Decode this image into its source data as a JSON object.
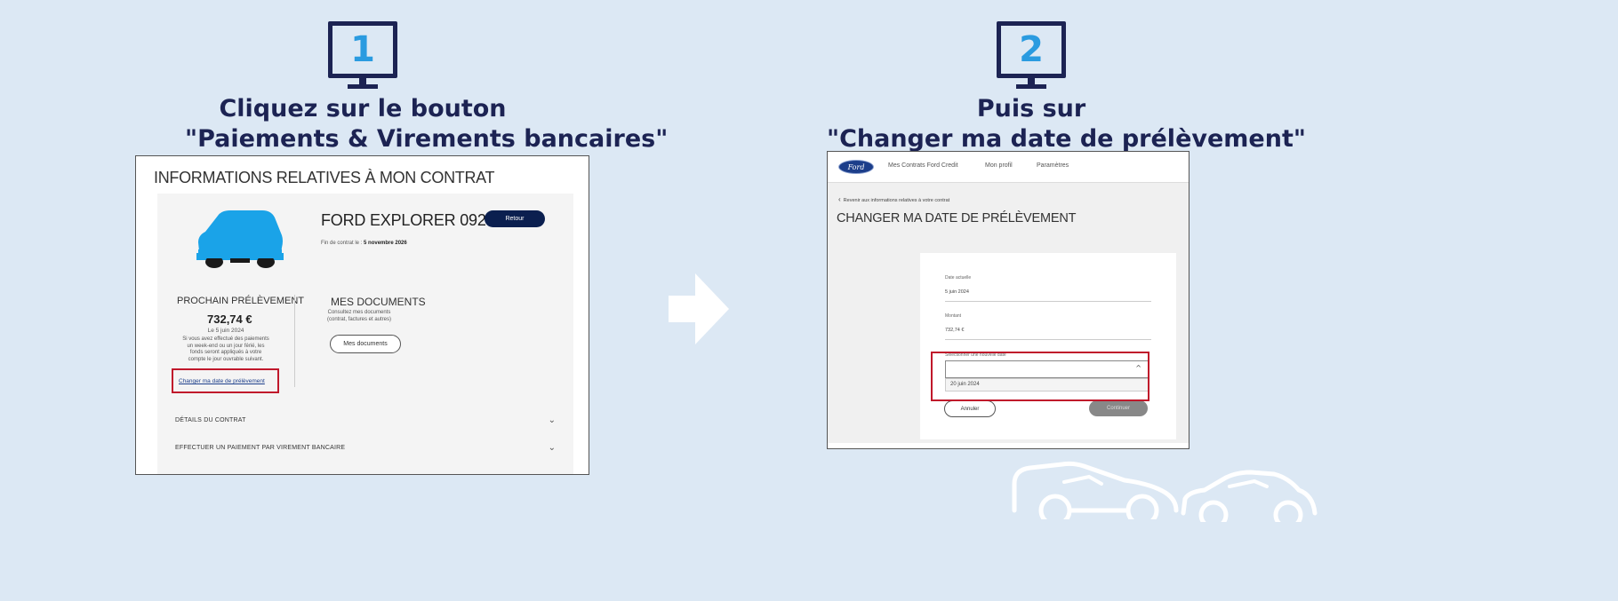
{
  "step1": {
    "number": "1",
    "title_line1": "Cliquez sur le bouton",
    "title_line2": "\"Paiements & Virements bancaires\""
  },
  "step2": {
    "number": "2",
    "title_line1": "Puis sur",
    "title_line2": "\"Changer ma date de prélèvement\""
  },
  "panel1": {
    "heading": "INFORMATIONS RELATIVES À MON CONTRAT",
    "model": "FORD EXPLORER 0920",
    "end_contract_label": "Fin de contrat le : ",
    "end_contract_date": "5 novembre 2026",
    "back_button": "Retour",
    "next_payment": {
      "title": "PROCHAIN PRÉLÈVEMENT",
      "amount": "732,74 €",
      "date": "Le 5 juin 2024",
      "note": "Si vous avez effectué des paiements un week-end ou un jour férié, les fonds seront appliqués à votre compte le jour ouvrable suivant.",
      "change_date_link": "Changer ma date de prélèvement"
    },
    "documents": {
      "title": "MES DOCUMENTS",
      "description": "Consultez mes documents (contrat, factures et autres)",
      "button": "Mes documents"
    },
    "accordion": [
      {
        "label": "DÉTAILS DU CONTRAT",
        "chevron": "⌄"
      },
      {
        "label": "EFFECTUER UN PAIEMENT PAR VIREMENT BANCAIRE",
        "chevron": "⌄"
      }
    ],
    "car_color": "#1aa3e8"
  },
  "panel2": {
    "logo": "Ford",
    "nav": [
      "Mes Contrats Ford Credit",
      "Mon profil",
      "Paramètres"
    ],
    "back_link": "Revenir aux informations relatives à votre contrat",
    "back_chevron": "‹",
    "title": "CHANGER MA DATE DE PRÉLÈVEMENT",
    "form": {
      "current_date_label": "Date actuelle",
      "current_date_value": "5 juin 2024",
      "amount_label": "Montant",
      "amount_value": "732,74 €",
      "new_date_label": "Sélectionner une nouvelle date",
      "new_date_option": "20 juin 2024",
      "select_chevron": "^",
      "cancel_button": "Annuler",
      "continue_button": "Continuer"
    }
  },
  "colors": {
    "background": "#dce8f4",
    "navy": "#1c2353",
    "accent_blue": "#2a9be0",
    "highlight_red": "#c0182b"
  }
}
